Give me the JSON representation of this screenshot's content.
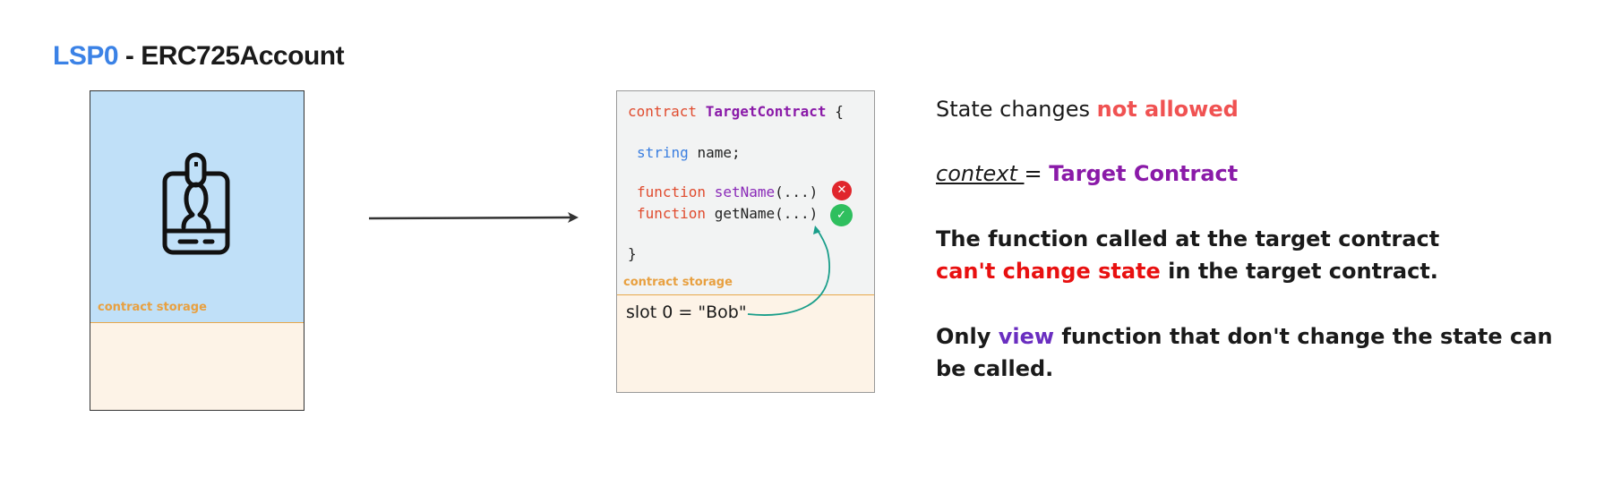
{
  "title": {
    "prefix": "LSP0",
    "suffix": " - ERC725Account",
    "prefix_color": "#3b82e6"
  },
  "account": {
    "icon": "id-badge-icon",
    "storage_label": "contract storage"
  },
  "arrow": {
    "icon": "right-arrow-icon"
  },
  "target_contract": {
    "line1": {
      "keyword": "contract",
      "name": "TargetContract",
      "brace": "{"
    },
    "line2": {
      "type": "string",
      "rest": "name;"
    },
    "functions": [
      {
        "keyword": "function",
        "name": "setName",
        "args": "(...)",
        "status": "not-allowed",
        "icon": "error-x-icon"
      },
      {
        "keyword": "function",
        "name": "getName",
        "args": "(...)",
        "status": "allowed",
        "icon": "check-icon"
      }
    ],
    "closing": "}",
    "storage_label": "contract storage",
    "slot_text": "slot 0 = \"Bob\""
  },
  "explanation": {
    "line1_plain": "State changes ",
    "line1_highlight": "not allowed",
    "context_label": "context ",
    "context_eq": "= ",
    "context_value": "Target Contract",
    "para1_line1": "The function called at the target contract",
    "para1_highlight": "can't change state",
    "para1_rest": " in the target contract.",
    "para2_prefix": "Only ",
    "para2_highlight": "view",
    "para2_rest": " function that don't change the state can",
    "para2_line2": "be called."
  },
  "colors": {
    "blue": "#3b82e6",
    "account_bg": "#c0e0f8",
    "storage_bg": "#fdf3e7",
    "storage_label": "#e8a040",
    "red": "#e81010",
    "purple": "#8a1aa8",
    "green": "#2fbf5e",
    "teal_arrow": "#1a9e8a"
  }
}
